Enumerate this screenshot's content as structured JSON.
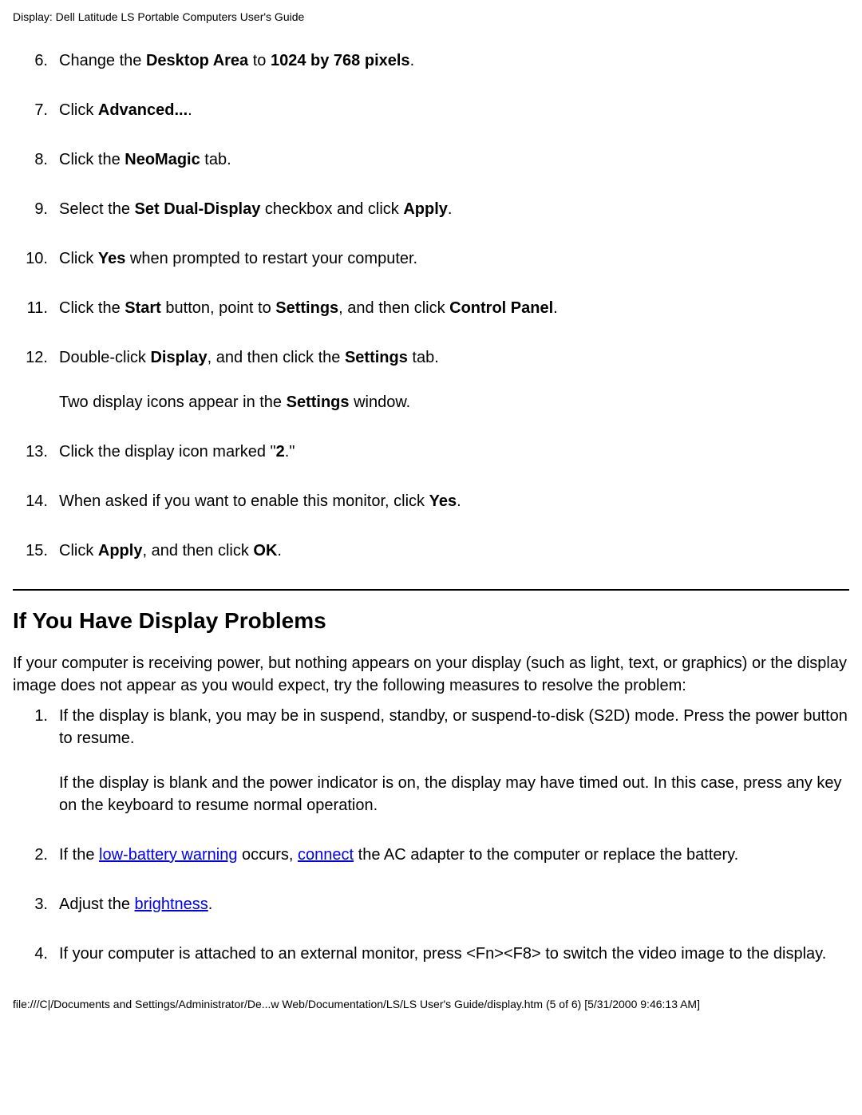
{
  "header": "Display: Dell Latitude LS Portable Computers User's Guide",
  "steps": [
    {
      "num": "6.",
      "html": "Change the <b>Desktop Area</b> to <b>1024 by 768 pixels</b>."
    },
    {
      "num": "7.",
      "html": "Click <b>Advanced...</b>."
    },
    {
      "num": "8.",
      "html": "Click the <b>NeoMagic</b> tab."
    },
    {
      "num": "9.",
      "html": "Select the <b>Set Dual-Display</b> checkbox and click <b>Apply</b>."
    },
    {
      "num": "10.",
      "html": "Click <b>Yes</b> when prompted to restart your computer."
    },
    {
      "num": "11.",
      "html": "Click the <b>Start</b> button, point to <b>Settings</b>, and then click <b>Control Panel</b>."
    },
    {
      "num": "12.",
      "html": "Double-click <b>Display</b>, and then click the <b>Settings</b> tab.",
      "extra": "Two display icons appear in the <b>Settings</b> window."
    },
    {
      "num": "13.",
      "html": "Click the display icon marked \"<b>2</b>.\""
    },
    {
      "num": "14.",
      "html": "When asked if you want to enable this monitor, click <b>Yes</b>."
    },
    {
      "num": "15.",
      "html": "Click <b>Apply</b>, and then click <b>OK</b>."
    }
  ],
  "section_heading": "If You Have Display Problems",
  "intro": "If your computer is receiving power, but nothing appears on your display (such as light, text, or graphics) or the display image does not appear as you would expect, try the following measures to resolve the problem:",
  "problems": [
    {
      "num": "1.",
      "html": "If the display is blank, you may be in suspend, standby, or suspend-to-disk (S2D) mode. Press the power button to resume.",
      "extra": "If the display is blank and the power indicator is on, the display may have timed out. In this case, press any key on the keyboard to resume normal operation."
    },
    {
      "num": "2.",
      "html": "If the <a href=\"#\" data-name=\"low-battery-warning-link\" data-interactable=\"true\">low-battery warning</a> occurs, <a href=\"#\" data-name=\"connect-link\" data-interactable=\"true\">connect</a> the AC adapter to the computer or replace the battery."
    },
    {
      "num": "3.",
      "html": "Adjust the <a href=\"#\" data-name=\"brightness-link\" data-interactable=\"true\">brightness</a>."
    },
    {
      "num": "4.",
      "html": "If your computer is attached to an external monitor, press &lt;Fn&gt;&lt;F8&gt; to switch the video image to the display."
    }
  ],
  "footer": "file:///C|/Documents and Settings/Administrator/De...w Web/Documentation/LS/LS User's Guide/display.htm (5 of 6) [5/31/2000 9:46:13 AM]"
}
